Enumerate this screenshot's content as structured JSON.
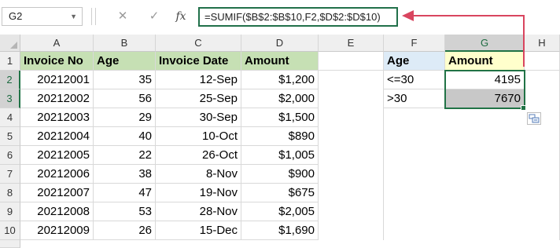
{
  "formula_bar": {
    "name_box": "G2",
    "cancel_icon": "✕",
    "enter_icon": "✓",
    "fx_label": "fx",
    "formula": "=SUMIF($B$2:$B$10,F2,$D$2:$D$10)"
  },
  "columns": [
    "A",
    "B",
    "C",
    "D",
    "E",
    "F",
    "G",
    "H"
  ],
  "rows": [
    "1",
    "2",
    "3",
    "4",
    "5",
    "6",
    "7",
    "8",
    "9",
    "10"
  ],
  "headers": {
    "invoice_no": "Invoice No",
    "age": "Age",
    "invoice_date": "Invoice Date",
    "amount": "Amount"
  },
  "data_rows": [
    {
      "invoice": "20212001",
      "age": "35",
      "date": "12-Sep",
      "amount": "$1,200"
    },
    {
      "invoice": "20212002",
      "age": "56",
      "date": "25-Sep",
      "amount": "$2,000"
    },
    {
      "invoice": "20212003",
      "age": "29",
      "date": "30-Sep",
      "amount": "$1,500"
    },
    {
      "invoice": "20212004",
      "age": "40",
      "date": "10-Oct",
      "amount": "$890"
    },
    {
      "invoice": "20212005",
      "age": "22",
      "date": "26-Oct",
      "amount": "$1,005"
    },
    {
      "invoice": "20212006",
      "age": "38",
      "date": "8-Nov",
      "amount": "$900"
    },
    {
      "invoice": "20212007",
      "age": "47",
      "date": "19-Nov",
      "amount": "$675"
    },
    {
      "invoice": "20212008",
      "age": "53",
      "date": "28-Nov",
      "amount": "$2,005"
    },
    {
      "invoice": "20212009",
      "age": "26",
      "date": "15-Dec",
      "amount": "$1,690"
    }
  ],
  "summary": {
    "age_header": "Age",
    "amount_header": "Amount",
    "rows": [
      {
        "criteria": "<=30",
        "amount": "4195"
      },
      {
        "criteria": ">30",
        "amount": "7670"
      }
    ]
  },
  "colors": {
    "selection": "#217346",
    "arrow": "#d9455f",
    "header_green": "#c6e0b4",
    "header_blue": "#ddebf7",
    "header_yellow": "#ffffcc"
  }
}
